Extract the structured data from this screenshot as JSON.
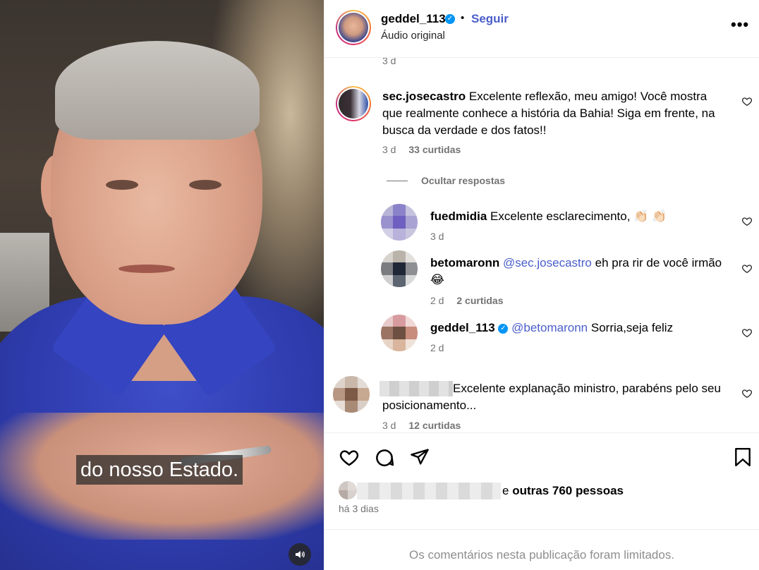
{
  "header": {
    "username": "geddel_113",
    "dot": "•",
    "follow_label": "Seguir",
    "audio_label": "Áudio original",
    "more_label": "•••"
  },
  "media": {
    "caption": "do nosso Estado."
  },
  "comments": {
    "top_time": "3 d",
    "main": {
      "username": "sec.josecastro",
      "text": "Excelente reflexão, meu amigo! Você mostra que realmente conhece a história da Bahia! Siga em frente, na busca da verdade e dos fatos!!",
      "time": "3 d",
      "likes": "33 curtidas"
    },
    "hide_replies_label": "Ocultar respostas",
    "replies": [
      {
        "username": "fuedmidia",
        "text": "Excelente esclarecimento, 👏🏻 👏🏻",
        "time": "3 d",
        "likes": ""
      },
      {
        "username": "betomaronn",
        "mention": "@sec.josecastro",
        "text": " eh pra rir de você irmão 😂",
        "time": "2 d",
        "likes": "2 curtidas"
      },
      {
        "username": "geddel_113",
        "mention": "@betomaronn",
        "text": " Sorria,seja feliz",
        "time": "2 d",
        "likes": ""
      }
    ],
    "last": {
      "text": "Excelente explanação ministro, parabéns pelo seu posicionamento...",
      "time": "3 d",
      "likes": "12 curtidas"
    }
  },
  "actions": {
    "likes_prefix": "e ",
    "likes_count": "outras 760 pessoas",
    "posted": "há 3 dias"
  },
  "footer": {
    "limited_text": "Os comentários nesta publicação foram limitados."
  },
  "colors": {
    "accent": "#4a5eca",
    "verified": "#0095f6",
    "muted": "#737373"
  }
}
